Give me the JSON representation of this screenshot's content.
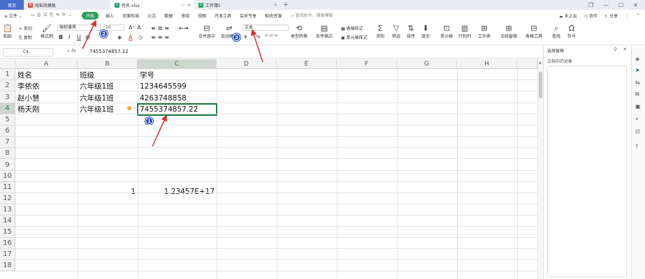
{
  "tabs": {
    "home": "首页",
    "template_tab": "找稻壳模板",
    "doc_tab": "姓名.xlsx",
    "workbook_tab": "工作簿1",
    "new_tab": "+"
  },
  "window_controls": {
    "restore": "❐",
    "minimize": "—",
    "maximize": "☐",
    "close": "✕"
  },
  "menubar": {
    "file": "≡ 文件 ⌄",
    "items": [
      "开始",
      "插入",
      "页面布局",
      "公式",
      "数据",
      "审阅",
      "视图",
      "开发工具",
      "会员专享",
      "稻壳资源"
    ],
    "search": "查找命令、搜索模板",
    "cloud": "未上云",
    "collab": "协作",
    "share": "分享"
  },
  "ribbon": {
    "paste": "粘贴",
    "cut": "剪切",
    "copy": "复制",
    "format_painter": "格式刷",
    "font_name": "微软雅黑",
    "font_size": "10",
    "bold": "B",
    "italic": "I",
    "underline": "U",
    "font_color": "A",
    "merge_center": "合并居中",
    "auto_wrap": "自动换行",
    "number_format": "文本",
    "currency": "¥",
    "percent": "%",
    "type_convert": "类型转换",
    "cond_format": "条件格式",
    "table_style": "表格样式",
    "cell_style": "单元格样式",
    "sum": "求和",
    "filter": "筛选",
    "sort": "排序",
    "fill": "填充",
    "cell": "单元格",
    "row_col": "行和列",
    "worksheet": "工作表",
    "freeze": "冻结窗格",
    "table_tools": "表格工具",
    "find": "查找",
    "symbol": "符号"
  },
  "formula_bar": {
    "name_box": "C4",
    "fx": "fx",
    "value": "7455374857.22"
  },
  "columns": [
    "A",
    "B",
    "C",
    "D",
    "E",
    "F",
    "G",
    "H"
  ],
  "rows": [
    "1",
    "2",
    "3",
    "4",
    "5",
    "6",
    "7",
    "8",
    "9",
    "10",
    "11",
    "12",
    "13",
    "14",
    "15",
    "16",
    "17",
    "18"
  ],
  "cells": {
    "a1": "姓名",
    "b1": "班级",
    "c1": "学号",
    "a2": "李依依",
    "b2": "六年级1班",
    "c2": "1234645599",
    "a3": "赵小慧",
    "b3": "六年级1班",
    "c3": "4263748858",
    "a4": "杨天刚",
    "b4": "六年级1班",
    "c4": "7455374857.22",
    "b12": "1",
    "c12": "1.23457E+17"
  },
  "side_panel": {
    "title": "选择窗格",
    "subtitle": "文档中的对象"
  },
  "annotations": {
    "badge1": "1",
    "badge2": "2",
    "badge3": "3"
  },
  "colors": {
    "accent_green": "#1e7b46",
    "home_tab": "#4a6fd1",
    "start_pill": "#2e9e5b",
    "badge": "#2b4bb9",
    "arrow": "#d0312d"
  }
}
